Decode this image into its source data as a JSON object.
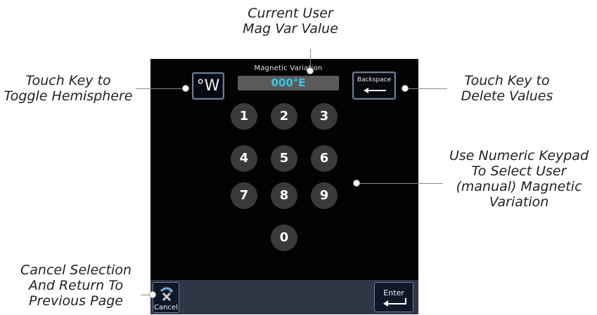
{
  "callouts": {
    "mag_var": [
      "Current User",
      "Mag Var Value"
    ],
    "hemisphere": [
      "Touch Key to",
      "Toggle Hemisphere"
    ],
    "delete": [
      "Touch Key to",
      "Delete Values"
    ],
    "keypad": [
      "Use Numeric Keypad",
      "To Select User",
      "(manual) Magnetic",
      "Variation"
    ],
    "cancel": [
      "Cancel Selection",
      "And Return To",
      "Previous Page"
    ]
  },
  "screen": {
    "hemisphere_key": "°W",
    "field_label": "Magnetic Variation",
    "field_value": "000°E",
    "backspace_label": "Backspace",
    "keypad": [
      "1",
      "2",
      "3",
      "4",
      "5",
      "6",
      "7",
      "8",
      "9",
      "0"
    ],
    "cancel_label": "Cancel",
    "enter_label": "Enter"
  },
  "icons": {
    "backspace": "left-arrow-icon",
    "cancel": "cancel-x-icon",
    "enter": "enter-return-icon"
  },
  "colors": {
    "screen_bg": "#030303",
    "value_text": "#39c6e8",
    "bottom_bar": "#2e3746",
    "key_border": "#6d7d94"
  }
}
